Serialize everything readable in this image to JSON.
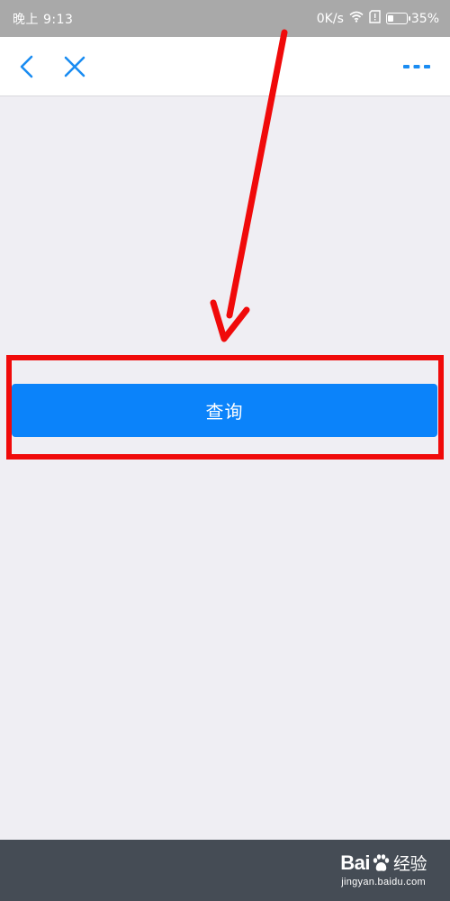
{
  "status_bar": {
    "time": "晚上 9:13",
    "network_speed": "0K/s",
    "battery_text": "35%",
    "battery_level": 0.35,
    "wifi_icon": "wifi-icon",
    "sim_icon": "sim-alert-icon"
  },
  "nav_bar": {
    "back_icon": "chevron-left-icon",
    "close_icon": "close-icon",
    "more_icon": "more-dots-icon",
    "title": ""
  },
  "main": {
    "query_button_label": "查询"
  },
  "footer": {
    "watermark_logo": "Bai",
    "watermark_logo_suffix": "经验",
    "watermark_url": "jingyan.baidu.com"
  },
  "colors": {
    "status_bar_bg": "#a9a9a9",
    "nav_icon": "#1a8cf2",
    "page_bg": "#efeef3",
    "button_bg": "#0b83fa",
    "annotation_red": "#f00a0a",
    "bottom_bar_bg": "#454c55"
  }
}
